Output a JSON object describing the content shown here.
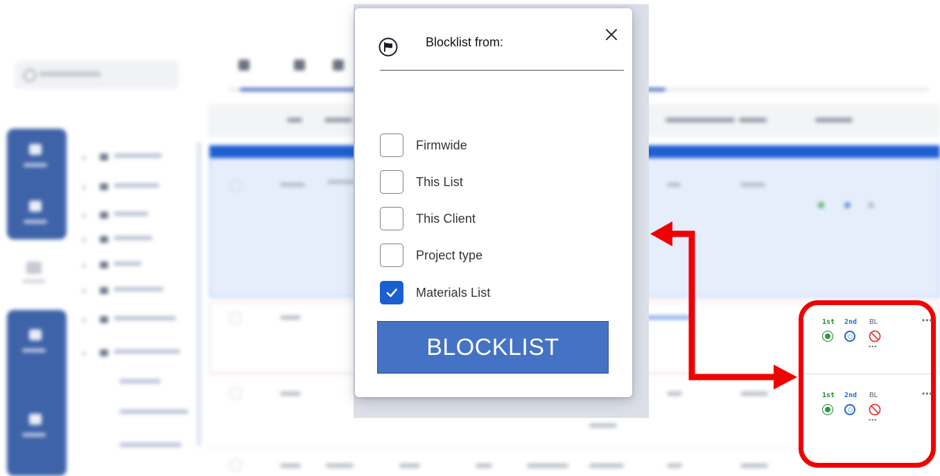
{
  "dialog": {
    "title": "Blocklist from:",
    "flag_icon": "flag-icon",
    "close_icon": "close-icon",
    "options": [
      {
        "label": "Firmwide",
        "checked": false
      },
      {
        "label": "This List",
        "checked": false
      },
      {
        "label": "This Client",
        "checked": false
      },
      {
        "label": "Project type",
        "checked": false
      },
      {
        "label": "Materials List",
        "checked": true
      }
    ],
    "action_label": "BLOCKLIST",
    "accent": "#1a5fd0",
    "button_color": "#4472c4"
  },
  "callout": {
    "rows": [
      {
        "first_label": "1st",
        "second_label": "2nd",
        "bl_label": "BL",
        "more": "•••",
        "sub_more": "•••"
      },
      {
        "first_label": "1st",
        "second_label": "2nd",
        "bl_label": "BL",
        "more": "•••",
        "sub_more": "•••"
      }
    ],
    "highlight_color": "#f00000"
  },
  "background": {
    "description_visible": false
  }
}
